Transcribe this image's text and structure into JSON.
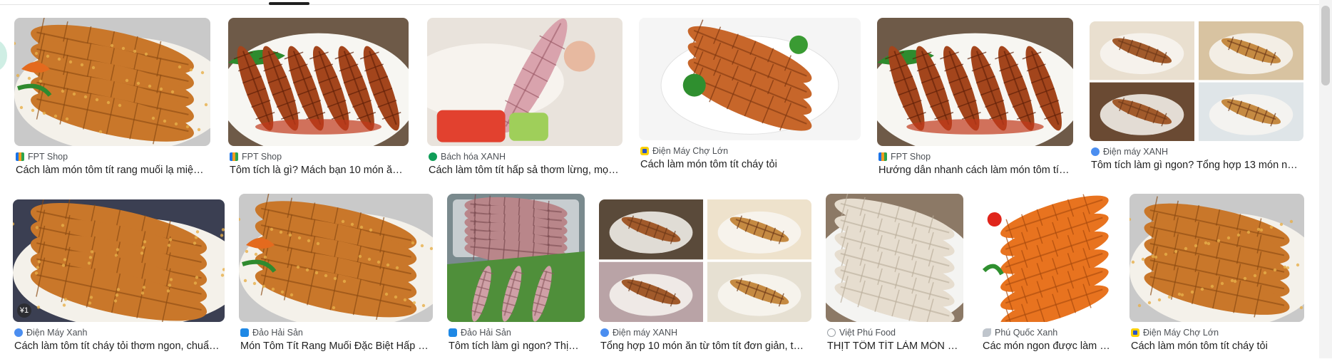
{
  "results": [
    {
      "source": "FPT Shop",
      "title": "Cách làm món tôm tít rang muối lạ miện…",
      "favicon": "fpt-shop-favicon"
    },
    {
      "source": "FPT Shop",
      "title": "Tôm tích là gì? Mách bạn 10 món ăn …",
      "favicon": "fpt-shop-favicon"
    },
    {
      "source": "Bách hóa XANH",
      "title": "Cách làm tôm tít hấp sả thơm lừng, mọ…",
      "favicon": "bach-hoa-xanh-favicon"
    },
    {
      "source": "Điện Máy Chợ Lớn",
      "title": "Cách làm món tôm tít cháy tỏi",
      "favicon": "dien-may-cho-lon-favicon"
    },
    {
      "source": "FPT Shop",
      "title": "Hướng dẫn nhanh cách làm món tôm tít…",
      "favicon": "fpt-shop-favicon"
    },
    {
      "source": "Điện máy XANH",
      "title": "Tôm tích làm gì ngon? Tổng hợp 13 món n…",
      "favicon": "dien-may-xanh-favicon"
    },
    {
      "source": "Điện Máy Xanh",
      "title": "Cách làm tôm tít cháy tỏi thơm ngon, chuẩ…",
      "favicon": "dien-may-xanh-favicon",
      "badge": "¥1"
    },
    {
      "source": "Đảo Hải Sản",
      "title": "Món Tôm Tít Rang Muối Đặc Biệt Hấp …",
      "favicon": "dao-hai-san-favicon"
    },
    {
      "source": "Đảo Hải Sản",
      "title": "Tôm tích làm gì ngon? Thị…",
      "favicon": "dao-hai-san-favicon"
    },
    {
      "source": "Điện máy XANH",
      "title": "Tổng hợp 10 món ăn từ tôm tít đơn giản, t…",
      "favicon": "dien-may-xanh-favicon"
    },
    {
      "source": "Việt Phú Food",
      "title": "THỊT TÔM TÍT LÀM MÓN …",
      "favicon": "viet-phu-food-favicon"
    },
    {
      "source": "Phú Quốc Xanh",
      "title": "Các món ngon được làm t…",
      "favicon": "phu-quoc-xanh-favicon"
    },
    {
      "source": "Điện Máy Chợ Lớn",
      "title": "Cách làm món tôm tít cháy tỏi",
      "favicon": "dien-may-cho-lon-favicon"
    }
  ],
  "colors": {
    "text": "#1f1f1f",
    "source_text": "#4d5156",
    "divider": "#e3e3e3",
    "tab_indicator": "#1f1f1f"
  }
}
